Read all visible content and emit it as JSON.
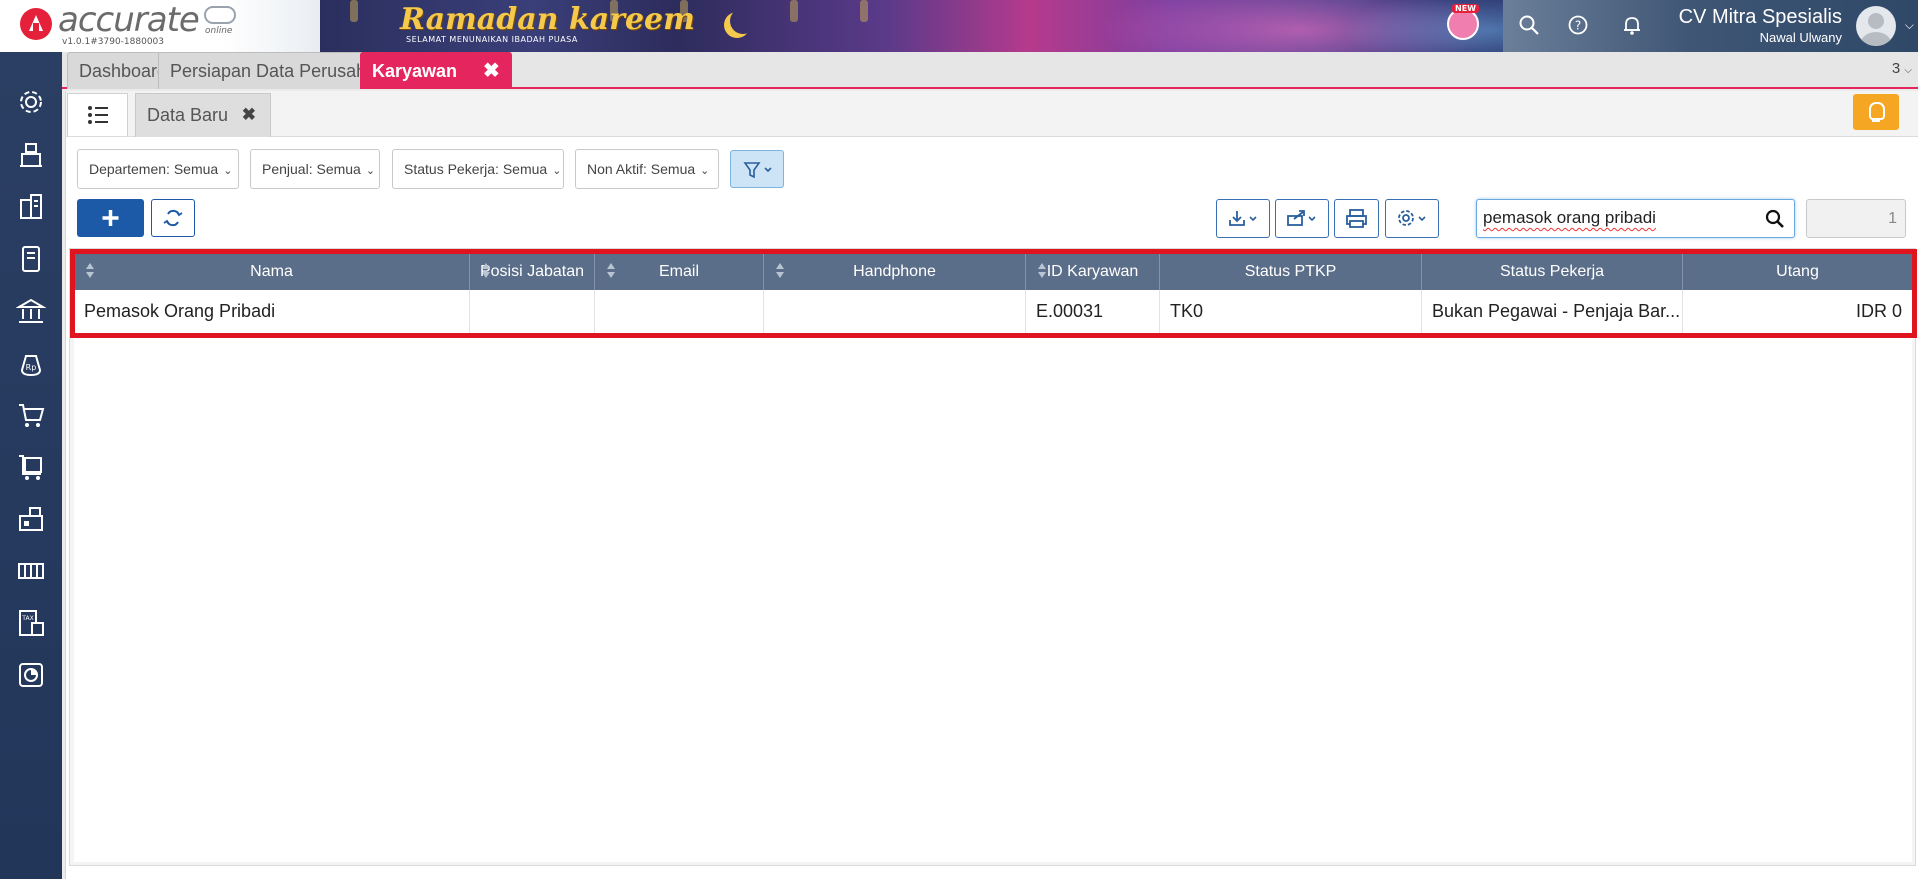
{
  "app": {
    "logo_text": "accurate",
    "logo_suffix": "online",
    "version": "v1.0.1#3790-1880003"
  },
  "banner": {
    "title": "Ramadan kareem",
    "subtitle": "SELAMAT MENUNAIKAN IBADAH PUASA",
    "badge": "NEW"
  },
  "user": {
    "company": "CV Mitra Spesialis",
    "name": "Nawal Ulwany"
  },
  "top_icons": [
    "search-icon",
    "help-icon",
    "bell-icon"
  ],
  "sidebar": {
    "icons": [
      "settings-icon",
      "cashier-icon",
      "company-icon",
      "ledger-icon",
      "bank-icon",
      "money-bag-icon",
      "cart-icon",
      "purchase-icon",
      "warehouse-icon",
      "assets-icon",
      "tax-icon",
      "report-icon"
    ]
  },
  "tabs": [
    {
      "label": "Dashboard"
    },
    {
      "label": "Persiapan Data Perusahaan"
    },
    {
      "label": "Karyawan",
      "active": true
    }
  ],
  "tab_count": "3",
  "subtab": {
    "label": "Data Baru"
  },
  "filters": [
    {
      "label": "Departemen: Semua"
    },
    {
      "label": "Penjual: Semua"
    },
    {
      "label": "Status Pekerja: Semua"
    },
    {
      "label": "Non Aktif: Semua"
    }
  ],
  "search": {
    "value": "pemasok orang pribadi"
  },
  "page_number": "1",
  "table": {
    "columns": [
      "Nama",
      "Posisi Jabatan",
      "Email",
      "Handphone",
      "ID Karyawan",
      "Status PTKP",
      "Status Pekerja",
      "Utang"
    ],
    "rows": [
      {
        "nama": "Pemasok Orang Pribadi",
        "posisi": "",
        "email": "",
        "handphone": "",
        "id": "E.00031",
        "ptkp": "TK0",
        "status_pekerja": "Bukan Pegawai - Penjaja Bar...",
        "utang": "IDR 0"
      }
    ]
  },
  "colors": {
    "accent": "#e5265e",
    "primary": "#1c5aa8",
    "header": "#5b6e89",
    "highlight": "#e0141e",
    "hint": "#f5a623"
  }
}
